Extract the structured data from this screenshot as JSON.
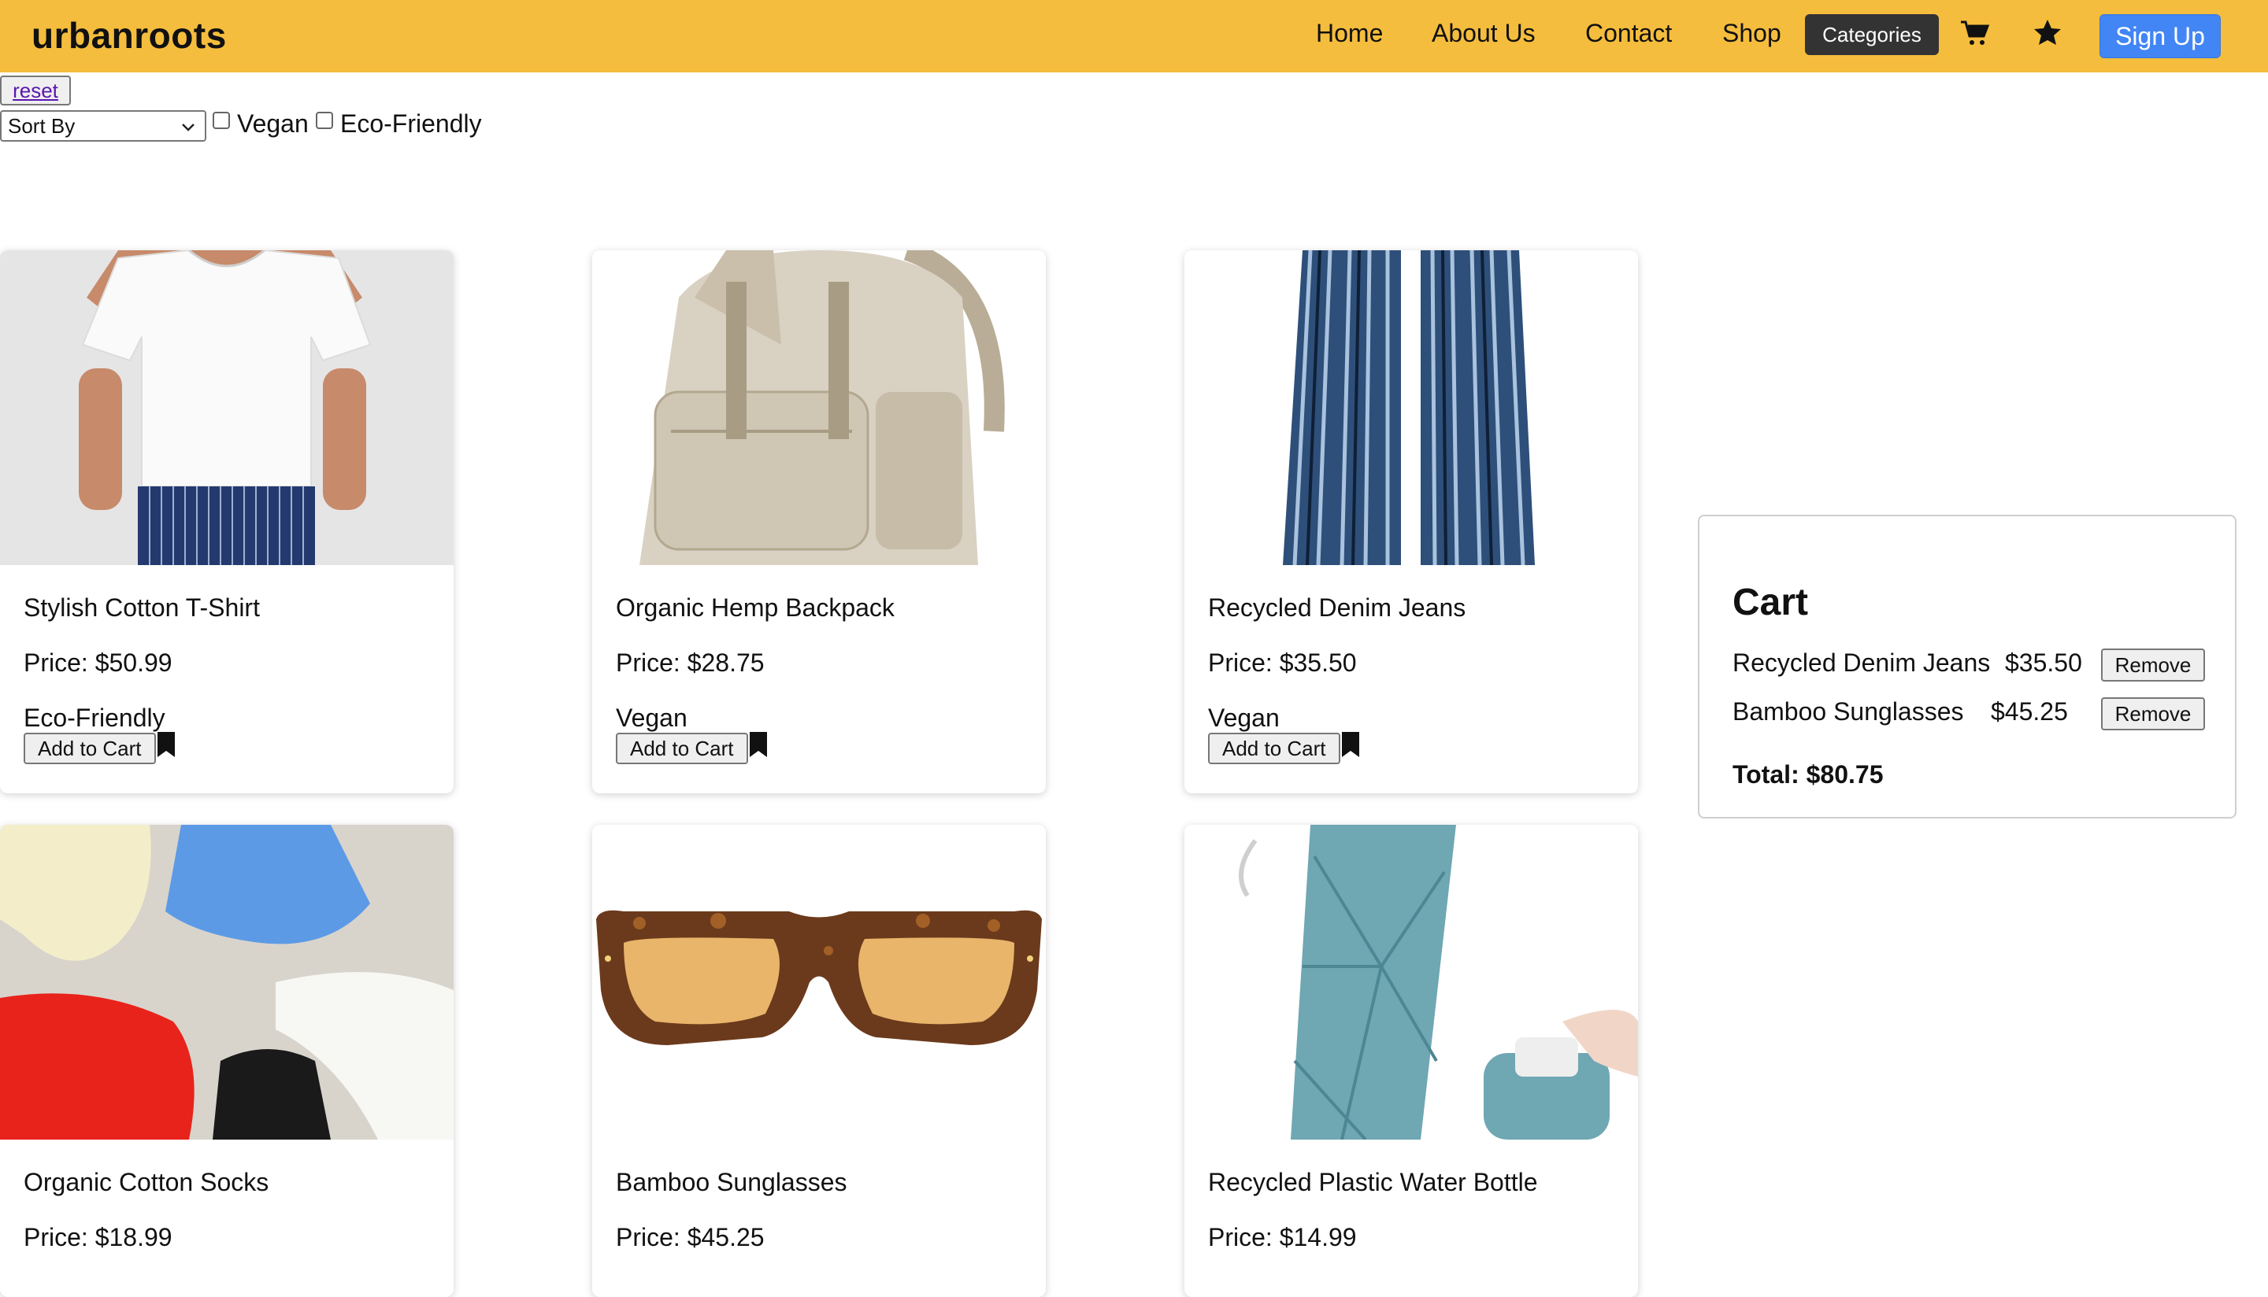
{
  "header": {
    "brand": "urbanroots",
    "nav": [
      "Home",
      "About Us",
      "Contact",
      "Shop"
    ],
    "categories_label": "Categories",
    "signup_label": "Sign Up",
    "icons": [
      "cart-icon",
      "star-icon"
    ],
    "colors": {
      "bar": "#f5bd3d",
      "signup": "#4285f4",
      "categories": "#333333"
    }
  },
  "filters": {
    "reset_label": "reset",
    "sort_label": "Sort By",
    "vegan_label": "Vegan",
    "vegan_checked": false,
    "eco_label": "Eco-Friendly",
    "eco_checked": false
  },
  "products": [
    {
      "name": "Stylish Cotton T-Shirt",
      "price": "Price: $50.99",
      "tag": "Eco-Friendly",
      "add_label": "Add to Cart"
    },
    {
      "name": "Organic Hemp Backpack",
      "price": "Price: $28.75",
      "tag": "Vegan",
      "add_label": "Add to Cart"
    },
    {
      "name": "Recycled Denim Jeans",
      "price": "Price: $35.50",
      "tag": "Vegan",
      "add_label": "Add to Cart"
    },
    {
      "name": "Organic Cotton Socks",
      "price": "Price: $18.99"
    },
    {
      "name": "Bamboo Sunglasses",
      "price": "Price: $45.25"
    },
    {
      "name": "Recycled Plastic Water Bottle",
      "price": "Price: $14.99"
    }
  ],
  "cart": {
    "title": "Cart",
    "items": [
      {
        "name": "Recycled Denim Jeans",
        "price": "$35.50",
        "remove_label": "Remove"
      },
      {
        "name": "Bamboo Sunglasses",
        "price": "$45.25",
        "remove_label": "Remove"
      }
    ],
    "total": "Total: $80.75"
  }
}
